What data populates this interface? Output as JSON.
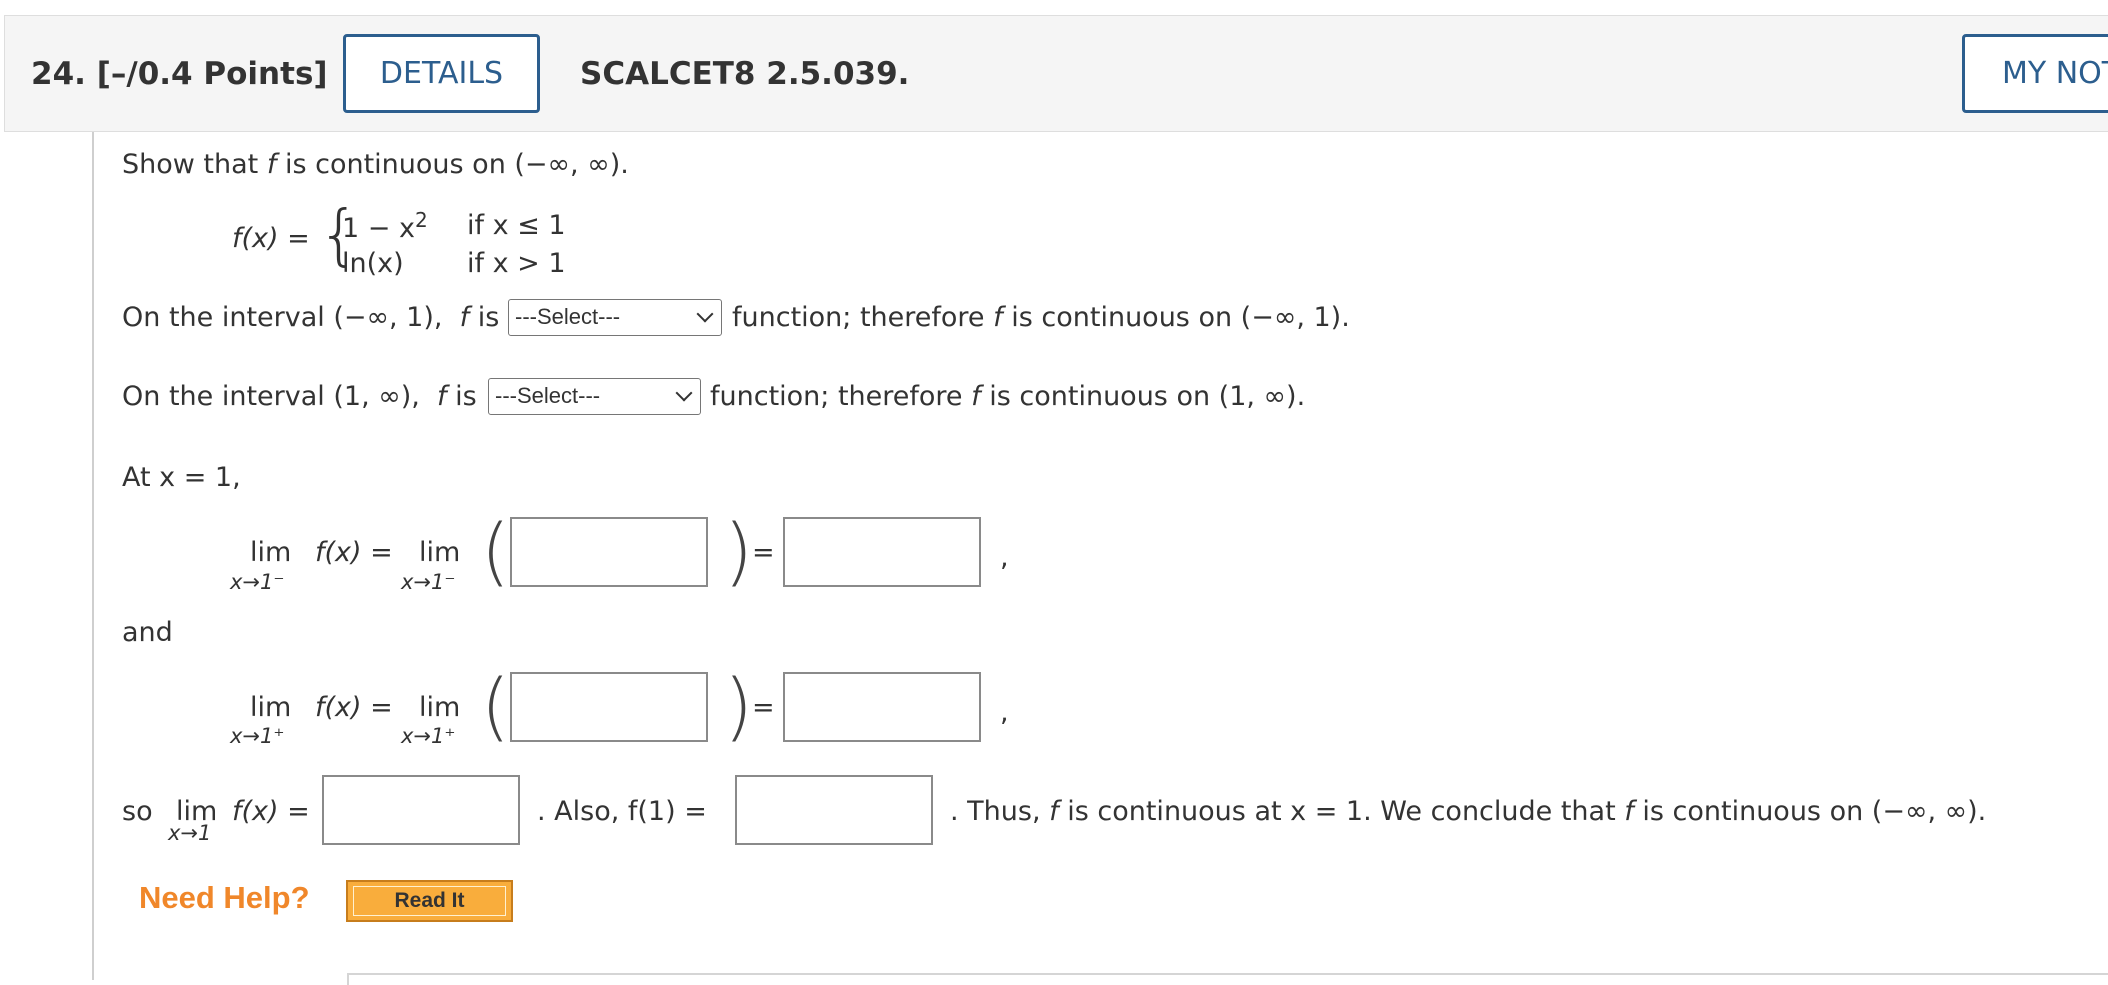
{
  "header": {
    "question_number": "24.",
    "points": "[–/0.4 Points]",
    "details_label": "DETAILS",
    "reference": "SCALCET8 2.5.039.",
    "my_notes_label": "MY NOTES"
  },
  "problem": {
    "intro_a": "Show that ",
    "intro_f": "f",
    "intro_b": " is continuous on (−∞, ∞).",
    "def_lhs": "f(x) =",
    "case1_expr": "1 − x",
    "case1_exp": "2",
    "case1_cond": "if x ≤ 1",
    "case2_expr": "ln(x)",
    "case2_cond": "if x > 1"
  },
  "line1": {
    "prefix": "On the interval  (−∞, 1),",
    "f": "f",
    "is": "is",
    "select_value": "---Select---",
    "suffix_a": "function; therefore ",
    "f2": "f",
    "suffix_b": " is continuous on  (−∞, 1)."
  },
  "line2": {
    "prefix": "On the interval  (1, ∞),",
    "f": "f",
    "is": "is",
    "select_value": "---Select---",
    "suffix_a": "function; therefore ",
    "f2": "f",
    "suffix_b": " is continuous on  (1, ∞)."
  },
  "at_x": "At  x = 1,",
  "limits": {
    "lim": "lim",
    "fx_eq": "f(x) =",
    "left_sub": "x→1⁻",
    "right_sub": "x→1⁺",
    "equals": "=",
    "comma": ",",
    "and": "and"
  },
  "conclusion": {
    "so": "so",
    "lim": "lim",
    "fx_eq": "f(x) =",
    "sub": "x→1",
    "also": ".  Also,  f(1) =",
    "thus_a": ".  Thus, ",
    "f": "f",
    "thus_b": " is continuous at  x = 1.  We conclude that ",
    "f2": "f",
    "thus_c": " is continuous on  (−∞, ∞)."
  },
  "help": {
    "label": "Need Help?",
    "read_it": "Read It"
  },
  "colors": {
    "accent": "#2c5e8e",
    "help": "#f0872a",
    "button": "#f9ad3c"
  }
}
